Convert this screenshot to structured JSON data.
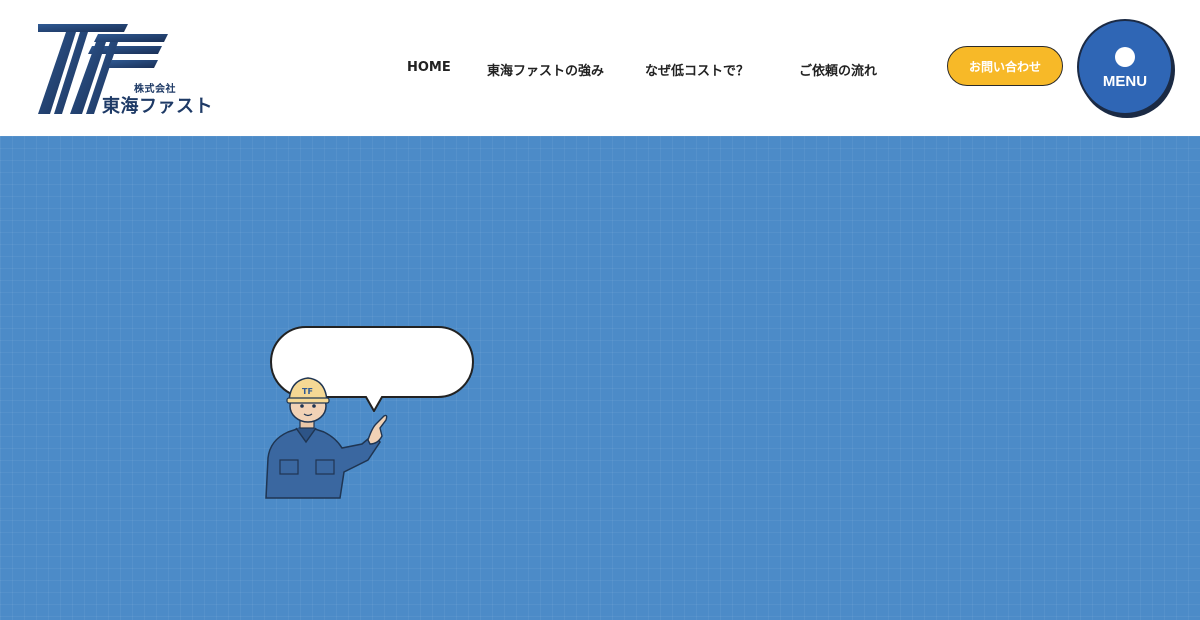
{
  "logo": {
    "company_type": "株式会社",
    "company_name": "東海ファスト",
    "mark_color": "#1e3a66"
  },
  "nav": {
    "items": [
      {
        "label": "HOME"
      },
      {
        "label": "東海ファストの強み"
      },
      {
        "label": "なぜ低コストで？"
      },
      {
        "label": "ご依頼の流れ"
      }
    ]
  },
  "contact_button": {
    "label": "お問い合わせ",
    "color": "#f7b928"
  },
  "menu_button": {
    "label": "MENU",
    "color": "#2f66b5"
  },
  "hero": {
    "background_color": "#4c8bc8",
    "speech_bubble_text": "",
    "icon": "worker-pointing-icon"
  }
}
